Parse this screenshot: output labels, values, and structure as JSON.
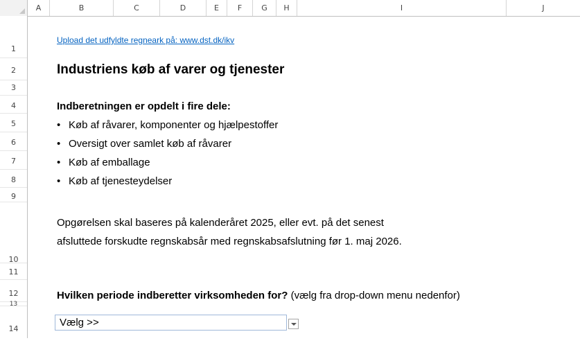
{
  "columns": [
    "A",
    "B",
    "C",
    "D",
    "E",
    "F",
    "G",
    "H",
    "I",
    "J"
  ],
  "rows": [
    "1",
    "2",
    "3",
    "4",
    "5",
    "6",
    "7",
    "8",
    "9",
    "10",
    "11",
    "12",
    "13",
    "14"
  ],
  "sheet": {
    "link_text": "Upload det udfyldte regneark på: www.dst.dk/ikv",
    "title": "Industriens køb af varer og tjenester",
    "intro_heading": "Indberetningen er opdelt i fire dele:",
    "bullet_char": "•",
    "bullets": [
      "Køb af råvarer, komponenter og hjælpestoffer",
      "Oversigt over samlet køb af råvarer",
      "Køb af emballage",
      "Køb af tjenesteydelser"
    ],
    "paragraph_line1": "Opgørelsen skal baseres på kalenderåret 2025, eller evt. på det senest",
    "paragraph_line2": "afsluttede forskudte regnskabsår med regnskabsafslutning før 1. maj 2026.",
    "question_bold": "Hvilken periode indberetter virksomheden for?",
    "question_note": " (vælg fra drop-down menu nedenfor)",
    "dropdown_value": "Vælg >>"
  },
  "colors": {
    "link": "#0563c1",
    "header_border": "#bfbfbf"
  }
}
